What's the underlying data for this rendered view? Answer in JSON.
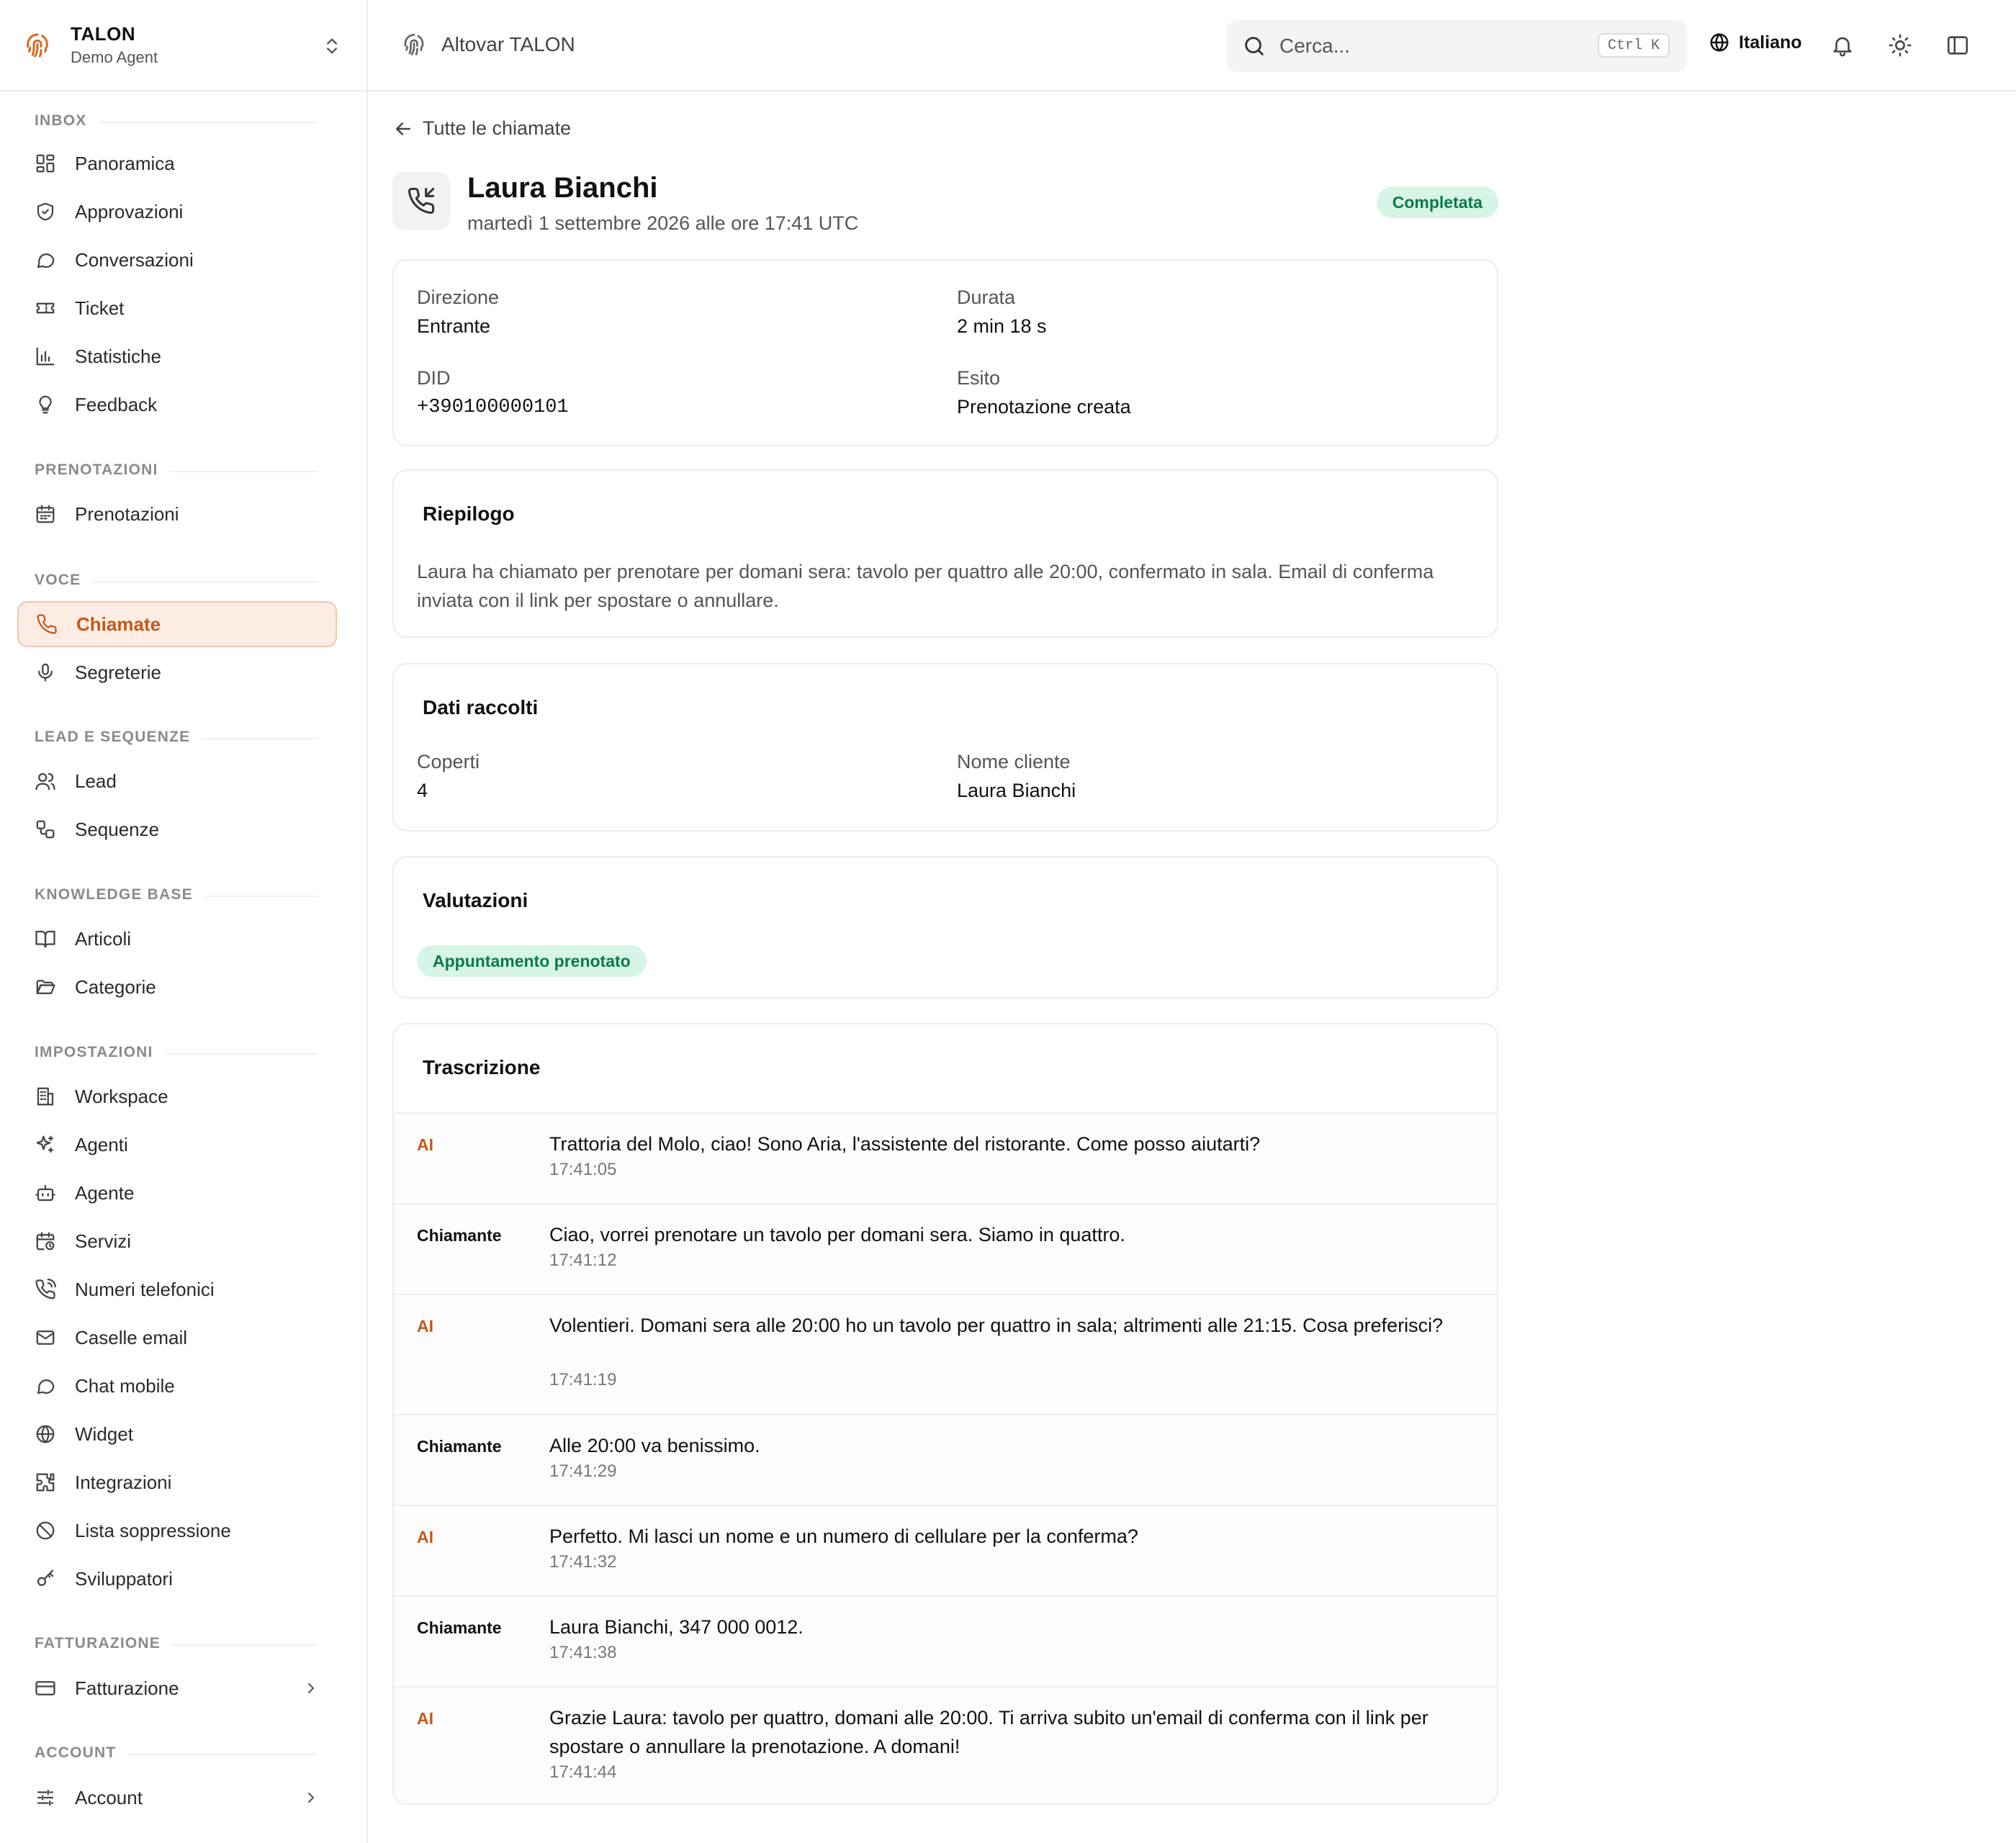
{
  "brand": {
    "name": "TALON",
    "subtitle": "Demo Agent"
  },
  "sidebar": {
    "sections": [
      {
        "title": "INBOX",
        "items": [
          {
            "label": "Panoramica",
            "icon": "dashboard-icon"
          },
          {
            "label": "Approvazioni",
            "icon": "shield-check-icon"
          },
          {
            "label": "Conversazioni",
            "icon": "chat-bubble-icon"
          },
          {
            "label": "Ticket",
            "icon": "ticket-icon"
          },
          {
            "label": "Statistiche",
            "icon": "bar-chart-icon"
          },
          {
            "label": "Feedback",
            "icon": "lightbulb-icon"
          }
        ]
      },
      {
        "title": "PRENOTAZIONI",
        "items": [
          {
            "label": "Prenotazioni",
            "icon": "calendar-icon"
          }
        ]
      },
      {
        "title": "VOCE",
        "items": [
          {
            "label": "Chiamate",
            "icon": "phone-icon",
            "active": true
          },
          {
            "label": "Segreterie",
            "icon": "microphone-icon"
          }
        ]
      },
      {
        "title": "LEAD E SEQUENZE",
        "items": [
          {
            "label": "Lead",
            "icon": "users-icon"
          },
          {
            "label": "Sequenze",
            "icon": "workflow-icon"
          }
        ]
      },
      {
        "title": "KNOWLEDGE BASE",
        "items": [
          {
            "label": "Articoli",
            "icon": "book-icon"
          },
          {
            "label": "Categorie",
            "icon": "folder-open-icon"
          }
        ]
      },
      {
        "title": "IMPOSTAZIONI",
        "items": [
          {
            "label": "Workspace",
            "icon": "building-icon"
          },
          {
            "label": "Agenti",
            "icon": "sparkles-icon"
          },
          {
            "label": "Agente",
            "icon": "bot-icon"
          },
          {
            "label": "Servizi",
            "icon": "calendar-clock-icon"
          },
          {
            "label": "Numeri telefonici",
            "icon": "phone-call-icon"
          },
          {
            "label": "Caselle email",
            "icon": "mail-icon"
          },
          {
            "label": "Chat mobile",
            "icon": "message-circle-icon"
          },
          {
            "label": "Widget",
            "icon": "globe-icon"
          },
          {
            "label": "Integrazioni",
            "icon": "puzzle-icon"
          },
          {
            "label": "Lista soppressione",
            "icon": "ban-icon"
          },
          {
            "label": "Sviluppatori",
            "icon": "key-icon"
          }
        ]
      },
      {
        "title": "FATTURAZIONE",
        "items": [
          {
            "label": "Fatturazione",
            "icon": "credit-card-icon",
            "chevron": true
          }
        ]
      },
      {
        "title": "ACCOUNT",
        "items": [
          {
            "label": "Account",
            "icon": "sliders-icon",
            "chevron": true
          }
        ]
      }
    ]
  },
  "topbar": {
    "breadcrumb": "Altovar TALON",
    "search_placeholder": "Cerca...",
    "search_shortcut": "Ctrl K",
    "language": "Italiano"
  },
  "call": {
    "back_label": "Tutte le chiamate",
    "caller_name": "Laura Bianchi",
    "date": "martedì 1 settembre 2026 alle ore 17:41 UTC",
    "status": "Completata",
    "details": {
      "direction_label": "Direzione",
      "direction_value": "Entrante",
      "duration_label": "Durata",
      "duration_value": "2 min 18 s",
      "did_label": "DID",
      "did_value": "+390100000101",
      "outcome_label": "Esito",
      "outcome_value": "Prenotazione creata"
    },
    "summary": {
      "title": "Riepilogo",
      "text": "Laura ha chiamato per prenotare per domani sera: tavolo per quattro alle 20:00, confermato in sala. Email di conferma inviata con il link per spostare o annullare."
    },
    "collected": {
      "title": "Dati raccolti",
      "covers_label": "Coperti",
      "covers_value": "4",
      "customer_label": "Nome cliente",
      "customer_value": "Laura Bianchi"
    },
    "evaluations": {
      "title": "Valutazioni",
      "tag": "Appuntamento prenotato"
    },
    "transcript": {
      "title": "Trascrizione",
      "entries": [
        {
          "speaker": "AI",
          "text": "Trattoria del Molo, ciao! Sono Aria, l'assistente del ristorante. Come posso aiutarti?",
          "time": "17:41:05"
        },
        {
          "speaker": "Chiamante",
          "text": "Ciao, vorrei prenotare un tavolo per domani sera. Siamo in quattro.",
          "time": "17:41:12"
        },
        {
          "speaker": "AI",
          "text": "Volentieri. Domani sera alle 20:00 ho un tavolo per quattro in sala; altrimenti alle 21:15. Cosa preferisci?",
          "time": "17:41:19"
        },
        {
          "speaker": "Chiamante",
          "text": "Alle 20:00 va benissimo.",
          "time": "17:41:29"
        },
        {
          "speaker": "AI",
          "text": "Perfetto. Mi lasci un nome e un numero di cellulare per la conferma?",
          "time": "17:41:32"
        },
        {
          "speaker": "Chiamante",
          "text": "Laura Bianchi, 347 000 0012.",
          "time": "17:41:38"
        },
        {
          "speaker": "AI",
          "text": "Grazie Laura: tavolo per quattro, domani alle 20:00. Ti arriva subito un'email di conferma con il link per spostare o annullare la prenotazione. A domani!",
          "time": "17:41:44"
        }
      ]
    }
  },
  "colors": {
    "accent": "#c25a1c",
    "active_bg": "#fdece3",
    "success_bg": "#d6f5e6",
    "success_text": "#0b7a4b"
  }
}
